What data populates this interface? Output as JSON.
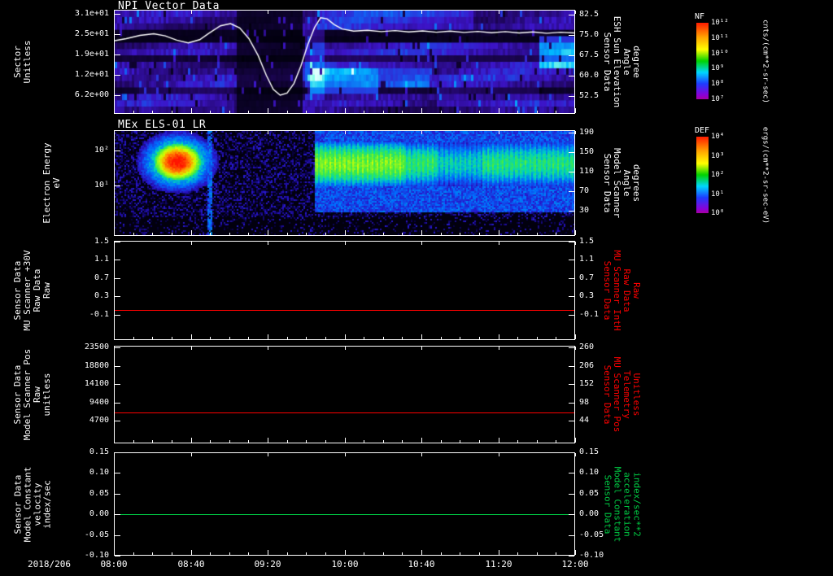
{
  "app": {
    "background": "#000000"
  },
  "palette": {
    "white": "#ffffff",
    "red": "#ff0000",
    "green": "#00cc44"
  },
  "chart_data": {
    "type": "multi-panel-time-series",
    "time_axis": {
      "date_label": "2018/206",
      "tick_labels": [
        "08:00",
        "08:40",
        "09:20",
        "10:00",
        "10:40",
        "11:20",
        "12:00"
      ],
      "minor_ticks_per_major": 4
    },
    "colorbar_gradient": [
      [
        0,
        255,
        30,
        0
      ],
      [
        0.18,
        255,
        160,
        0
      ],
      [
        0.35,
        255,
        255,
        0
      ],
      [
        0.5,
        0,
        210,
        0
      ],
      [
        0.65,
        0,
        215,
        255
      ],
      [
        0.8,
        30,
        60,
        255
      ],
      [
        0.95,
        140,
        0,
        215
      ],
      [
        1,
        165,
        0,
        165
      ]
    ],
    "panels": [
      {
        "type": "heatmap",
        "title": "NPI Vector Data",
        "left_axis": {
          "title_lines": [
            "Sector",
            "Unitless"
          ],
          "color": "#ffffff",
          "tick_labels": [
            "3.1e+01",
            "2.5e+01",
            "1.9e+01",
            "1.2e+01",
            "6.2e+00"
          ],
          "tick_values": [
            31,
            24.8,
            18.6,
            12.4,
            6.2
          ],
          "range": [
            32.2,
            0.5
          ]
        },
        "right_axis": {
          "title_lines": [
            "Sensor Data",
            "ESH Sun Elevation",
            "Angle",
            "degree"
          ],
          "color": "#ffffff",
          "tick_labels": [
            "82.5",
            "75.0",
            "67.5",
            "60.0",
            "52.5"
          ],
          "tick_values": [
            82.5,
            75.0,
            67.5,
            60.0,
            52.5
          ],
          "range": [
            84.3,
            45.9
          ]
        },
        "colorbar": {
          "title": "NF",
          "unit": "cnts/(cm**2-sr-sec)",
          "tick_labels": [
            "10¹²",
            "10¹¹",
            "10¹⁰",
            "10⁹",
            "10⁸",
            "10⁷"
          ]
        },
        "overlay_series": {
          "name": "ESH Sun Elevation Angle",
          "units": "degree",
          "color": "#ffffff",
          "points": [
            [
              0.0,
              73.0
            ],
            [
              0.025,
              73.8
            ],
            [
              0.055,
              75.0
            ],
            [
              0.085,
              75.6
            ],
            [
              0.11,
              74.8
            ],
            [
              0.135,
              73.2
            ],
            [
              0.16,
              72.2
            ],
            [
              0.185,
              73.4
            ],
            [
              0.205,
              75.8
            ],
            [
              0.23,
              78.6
            ],
            [
              0.252,
              79.4
            ],
            [
              0.272,
              77.8
            ],
            [
              0.292,
              73.8
            ],
            [
              0.312,
              67.5
            ],
            [
              0.33,
              60.0
            ],
            [
              0.345,
              54.8
            ],
            [
              0.36,
              52.6
            ],
            [
              0.375,
              53.4
            ],
            [
              0.39,
              57.0
            ],
            [
              0.405,
              63.5
            ],
            [
              0.42,
              71.5
            ],
            [
              0.435,
              78.0
            ],
            [
              0.448,
              81.6
            ],
            [
              0.462,
              81.2
            ],
            [
              0.478,
              79.0
            ],
            [
              0.495,
              77.4
            ],
            [
              0.52,
              76.6
            ],
            [
              0.55,
              76.9
            ],
            [
              0.58,
              76.4
            ],
            [
              0.61,
              76.8
            ],
            [
              0.64,
              76.3
            ],
            [
              0.67,
              76.7
            ],
            [
              0.7,
              76.2
            ],
            [
              0.73,
              76.6
            ],
            [
              0.76,
              76.1
            ],
            [
              0.79,
              76.5
            ],
            [
              0.82,
              76.0
            ],
            [
              0.85,
              76.4
            ],
            [
              0.88,
              75.9
            ],
            [
              0.91,
              76.3
            ],
            [
              0.94,
              75.8
            ],
            [
              0.97,
              76.2
            ],
            [
              1.0,
              75.9
            ]
          ]
        },
        "palette": [
          [
            0,
            0,
            0,
            10
          ],
          [
            0.18,
            30,
            5,
            90
          ],
          [
            0.35,
            60,
            20,
            200
          ],
          [
            0.55,
            20,
            90,
            240
          ],
          [
            0.75,
            0,
            190,
            255
          ],
          [
            0.9,
            130,
            255,
            230
          ],
          [
            1,
            220,
            255,
            255
          ]
        ],
        "features": {
          "rows": 16,
          "row_base": [
            0.34,
            0.3,
            0.28,
            0.07,
            0.05,
            0.3,
            0.33,
            0.1,
            0.3,
            0.36,
            0.4,
            0.36,
            0.1,
            0.28,
            0.33,
            0.26
          ],
          "dark_interval": [
            0.265,
            0.405
          ],
          "bright_segments": [
            [
              0.42,
              0.57,
              9,
              12,
              0.4
            ],
            [
              0.57,
              0.68,
              9,
              11,
              0.22
            ],
            [
              0.92,
              1.0,
              4,
              8,
              0.4
            ],
            [
              0.44,
              0.78,
              0,
              2,
              0.15
            ],
            [
              0.05,
              0.26,
              12,
              15,
              0.08
            ],
            [
              0.7,
              0.92,
              12,
              14,
              0.1
            ],
            [
              0.41,
              0.455,
              3,
              13,
              0.18
            ],
            [
              0.42,
              1.0,
              5,
              8,
              0.08
            ]
          ]
        }
      },
      {
        "type": "heatmap",
        "title": "MEx ELS-01 LR",
        "left_axis": {
          "title_lines": [
            "Electron Energy",
            "eV"
          ],
          "color": "#ffffff",
          "scale": "log",
          "tick_labels": [
            "10²",
            "10¹"
          ],
          "tick_values": [
            100,
            10
          ],
          "range": [
            380,
            0.35
          ]
        },
        "right_axis": {
          "title_lines": [
            "Sensor Data",
            "Model Scanner",
            "Angle",
            "degrees"
          ],
          "color": "#ffffff",
          "tick_labels": [
            "190",
            "150",
            "110",
            "70",
            "30"
          ],
          "tick_values": [
            190,
            150,
            110,
            70,
            30
          ],
          "range": [
            195,
            -22
          ]
        },
        "colorbar": {
          "title": "DEF",
          "unit": "ergs/(cm**2-sr-sec-eV)",
          "tick_labels": [
            "10⁴",
            "10³",
            "10²",
            "10¹",
            "10⁰"
          ]
        },
        "palette": [
          [
            0,
            0,
            0,
            0
          ],
          [
            0.1,
            8,
            0,
            70
          ],
          [
            0.25,
            40,
            20,
            200
          ],
          [
            0.4,
            0,
            110,
            255
          ],
          [
            0.52,
            0,
            210,
            190
          ],
          [
            0.64,
            60,
            235,
            70
          ],
          [
            0.78,
            210,
            255,
            0
          ],
          [
            0.88,
            255,
            150,
            0
          ],
          [
            1,
            255,
            20,
            0
          ]
        ],
        "features": {
          "blob": {
            "x": 0.135,
            "y": 0.29,
            "rx": 0.05,
            "ry": 0.17
          },
          "spike_x": 0.205,
          "band": {
            "x0": 0.435,
            "y0": 0.1,
            "y1": 0.52
          },
          "subband_y1": 0.78
        }
      },
      {
        "type": "line",
        "left_axis": {
          "title_lines": [
            "Sensor Data",
            "MU Scanner +30V",
            "Raw Data",
            "Raw"
          ],
          "color": "#ffffff",
          "tick_labels": [
            "1.5",
            "1.1",
            "0.7",
            "0.3",
            "-0.1"
          ],
          "tick_values": [
            1.5,
            1.1,
            0.7,
            0.3,
            -0.1
          ],
          "range": [
            1.51,
            -0.66
          ]
        },
        "right_axis": {
          "title_lines": [
            "Sensor Data",
            "MU Scanner IntH",
            "Raw Data",
            "Raw"
          ],
          "color": "#ff0000",
          "tick_labels": [
            "1.5",
            "1.1",
            "0.7",
            "0.3",
            "-0.1"
          ],
          "tick_values": [
            1.5,
            1.1,
            0.7,
            0.3,
            -0.1
          ],
          "range": [
            1.51,
            -0.66
          ]
        },
        "series": [
          {
            "name": "MU Scanner IntH Raw",
            "color": "#ff0000",
            "constant_value": 0.0
          }
        ]
      },
      {
        "type": "line",
        "left_axis": {
          "title_lines": [
            "Sensor Data",
            "Model Scanner Pos",
            "Raw",
            "unitless"
          ],
          "color": "#ffffff",
          "tick_labels": [
            "23500",
            "18800",
            "14100",
            "9400",
            "4700"
          ],
          "tick_values": [
            23500,
            18800,
            14100,
            9400,
            4700
          ],
          "range": [
            24000,
            -1067
          ]
        },
        "right_axis": {
          "title_lines": [
            "Sensor Data",
            "MU Scanner Pos",
            "Telemetry",
            "Unitless"
          ],
          "color": "#ff0000",
          "tick_labels": [
            "260",
            "206",
            "152",
            "98",
            "44"
          ],
          "tick_values": [
            260,
            206,
            152,
            98,
            44
          ],
          "range": [
            265.8,
            -22.2
          ]
        },
        "series": [
          {
            "name": "Model Scanner Pos Raw",
            "color": "#ff0000",
            "constant_value": 6900
          }
        ]
      },
      {
        "type": "line",
        "left_axis": {
          "title_lines": [
            "Sensor Data",
            "Model Constant",
            "velocity",
            "index/sec"
          ],
          "color": "#ffffff",
          "tick_labels": [
            "0.15",
            "0.10",
            "0.05",
            "0.00",
            "-0.05",
            "-0.10"
          ],
          "tick_values": [
            0.15,
            0.1,
            0.05,
            0.0,
            -0.05,
            -0.1
          ],
          "range": [
            0.15,
            -0.1
          ]
        },
        "right_axis": {
          "title_lines": [
            "Sensor Data",
            "Model Constant",
            "acceleration",
            "index/sec**2"
          ],
          "color": "#00cc44",
          "tick_labels": [
            "0.15",
            "0.10",
            "0.05",
            "0.00",
            "-0.05",
            "-0.10"
          ],
          "tick_values": [
            0.15,
            0.1,
            0.05,
            0.0,
            -0.05,
            -0.1
          ],
          "range": [
            0.15,
            -0.1
          ]
        },
        "series": [
          {
            "name": "Model Constant acceleration",
            "color": "#00cc44",
            "constant_value": 0.0
          }
        ]
      }
    ]
  }
}
